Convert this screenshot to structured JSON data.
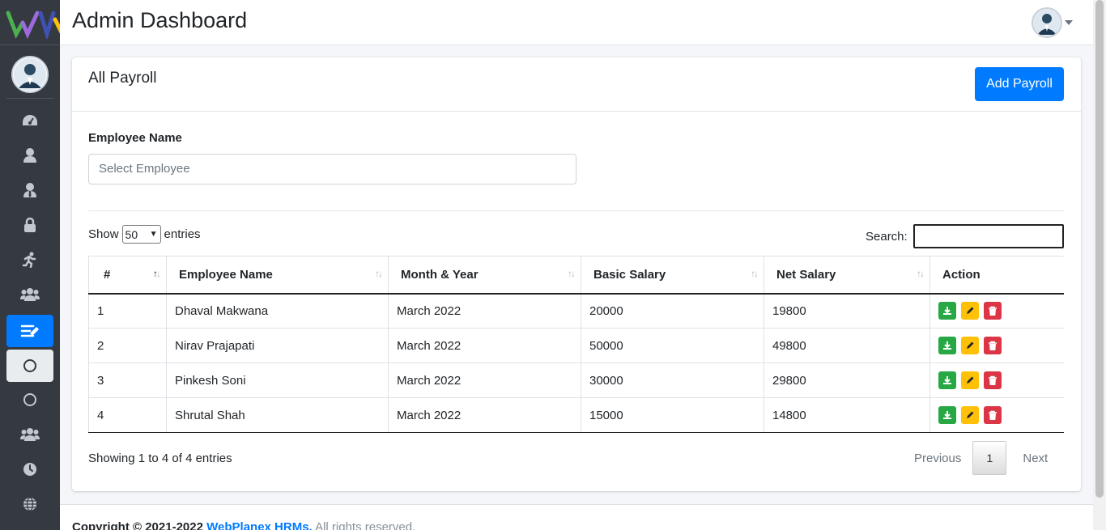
{
  "header": {
    "title": "Admin Dashboard"
  },
  "sidebar": {
    "items": [
      {
        "icon": "tachometer-icon"
      },
      {
        "icon": "user-icon"
      },
      {
        "icon": "user-tie-icon"
      },
      {
        "icon": "lock-icon"
      },
      {
        "icon": "running-icon"
      },
      {
        "icon": "users-icon"
      },
      {
        "icon": "payroll-list-icon",
        "active": true
      },
      {
        "icon": "circle-icon",
        "open": true
      },
      {
        "icon": "circle-icon"
      },
      {
        "icon": "users-icon"
      },
      {
        "icon": "clock-icon"
      },
      {
        "icon": "globe-icon"
      }
    ]
  },
  "card": {
    "title": "All Payroll",
    "add_button": "Add Payroll"
  },
  "filter": {
    "label": "Employee Name",
    "placeholder": "Select Employee"
  },
  "table_controls": {
    "show": "Show",
    "length": "50",
    "entries": "entries",
    "search_label": "Search:"
  },
  "table": {
    "columns": [
      "#",
      "Employee Name",
      "Month & Year",
      "Basic Salary",
      "Net Salary",
      "Action"
    ],
    "rows": [
      {
        "num": "1",
        "name": "Dhaval Makwana",
        "month": "March 2022",
        "basic": "20000",
        "net": "19800"
      },
      {
        "num": "2",
        "name": "Nirav Prajapati",
        "month": "March 2022",
        "basic": "50000",
        "net": "49800"
      },
      {
        "num": "3",
        "name": "Pinkesh Soni",
        "month": "March 2022",
        "basic": "30000",
        "net": "29800"
      },
      {
        "num": "4",
        "name": "Shrutal Shah",
        "month": "March 2022",
        "basic": "15000",
        "net": "14800"
      }
    ]
  },
  "pagination": {
    "info": "Showing 1 to 4 of 4 entries",
    "previous": "Previous",
    "page": "1",
    "next": "Next"
  },
  "footer": {
    "prefix": "Copyright © 2021-2022",
    "link": "WebPlanex HRMs.",
    "suffix": "All rights reserved."
  },
  "colors": {
    "primary": "#007bff",
    "sidebar": "#343a40",
    "download": "#28a745",
    "edit": "#ffc107",
    "delete": "#dc3545"
  }
}
